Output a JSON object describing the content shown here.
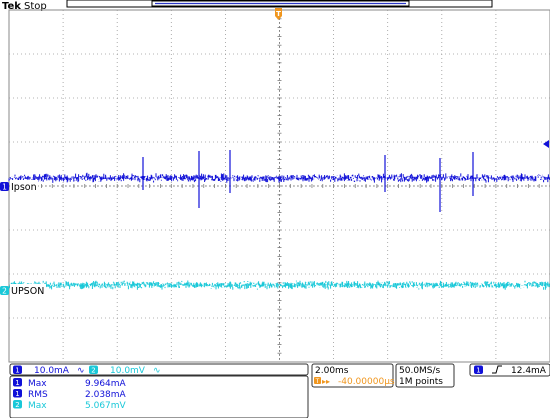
{
  "header": {
    "brand": "Tek",
    "run_state": "Stop",
    "trigger_marker": "T"
  },
  "channels": [
    {
      "id": "1",
      "label": "Ipson",
      "scale": "10.0mA",
      "color": "#1010d8"
    },
    {
      "id": "2",
      "label": "UPSON",
      "scale": "10.0mV",
      "color": "#19c8d8"
    }
  ],
  "measurements": [
    {
      "ch": "1",
      "name": "Max",
      "value": "9.964mA"
    },
    {
      "ch": "1",
      "name": "RMS",
      "value": "2.038mA"
    },
    {
      "ch": "2",
      "name": "Max",
      "value": "5.067mV"
    }
  ],
  "timebase": {
    "scale": "2.00ms",
    "position": "-40.00000µs"
  },
  "acquisition": {
    "rate": "50.0MS/s",
    "length": "1M points"
  },
  "trigger": {
    "source": "1",
    "slope_icon": "rising-edge-icon",
    "level": "12.4mA"
  },
  "colors": {
    "trigger": "#f0961e",
    "grid": "#9a9a9a",
    "background": "#ffffff"
  }
}
